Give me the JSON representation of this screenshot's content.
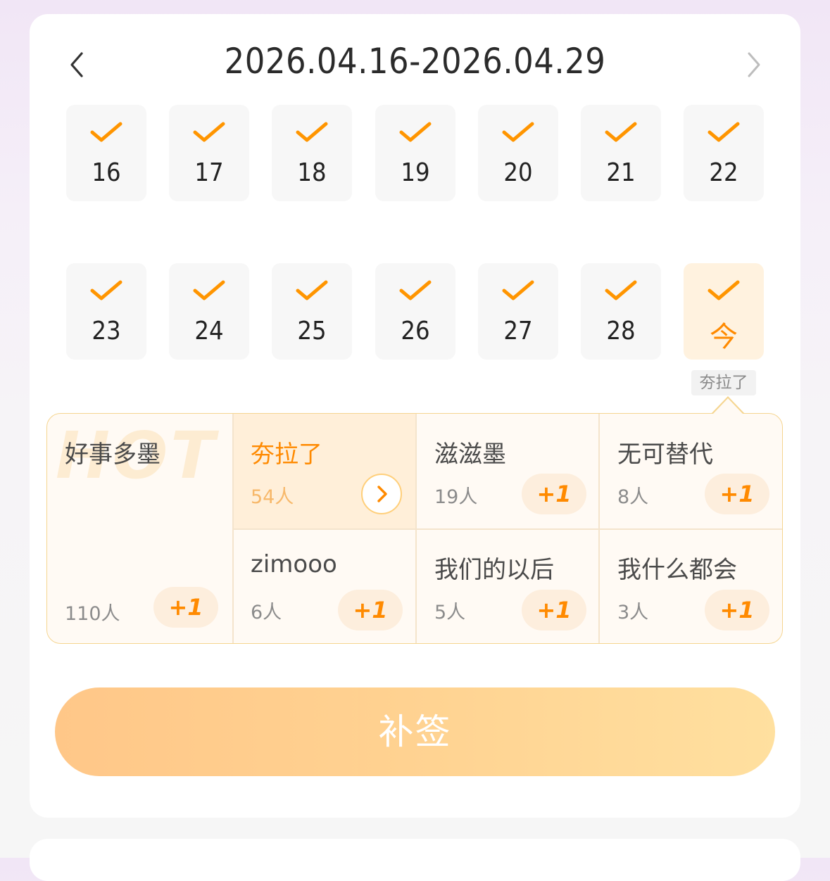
{
  "header": {
    "range": "2026.04.16-2026.04.29"
  },
  "colors": {
    "accent": "#ff8a00",
    "check": "#ff9500",
    "today_bg": "#fff2df",
    "button_start": "#ffc482",
    "button_end": "#ffde9a"
  },
  "days": [
    {
      "label": "16",
      "checked": true
    },
    {
      "label": "17",
      "checked": true
    },
    {
      "label": "18",
      "checked": true
    },
    {
      "label": "19",
      "checked": true
    },
    {
      "label": "20",
      "checked": true
    },
    {
      "label": "21",
      "checked": true
    },
    {
      "label": "22",
      "checked": true
    },
    {
      "label": "23",
      "checked": true
    },
    {
      "label": "24",
      "checked": true
    },
    {
      "label": "25",
      "checked": true
    },
    {
      "label": "26",
      "checked": true
    },
    {
      "label": "27",
      "checked": true
    },
    {
      "label": "28",
      "checked": true
    },
    {
      "label": "今",
      "checked": true
    }
  ],
  "today_tip": "夯拉了",
  "hot_badge": "HOT",
  "options": [
    {
      "name": "好事多墨",
      "count": "110人",
      "action": "+1"
    },
    {
      "name": "夯拉了",
      "count": "54人",
      "action": "go-icon"
    },
    {
      "name": "滋滋墨",
      "count": "19人",
      "action": "+1"
    },
    {
      "name": "无可替代",
      "count": "8人",
      "action": "+1"
    },
    {
      "name": "zimooo",
      "count": "6人",
      "action": "+1"
    },
    {
      "name": "我们的以后",
      "count": "5人",
      "action": "+1"
    },
    {
      "name": "我什么都会",
      "count": "3人",
      "action": "+1"
    }
  ],
  "resign_button": "补签"
}
